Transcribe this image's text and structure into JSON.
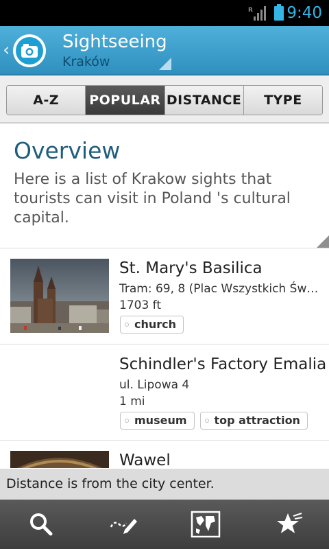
{
  "status_bar": {
    "time": "9:40",
    "roaming": "R",
    "accent_color": "#33b5e5"
  },
  "action_bar": {
    "title": "Sightseeing",
    "subtitle": "Kraków",
    "back_icon": "chevron-left-icon",
    "logo_icon": "camera-icon"
  },
  "tabs": [
    {
      "label": "A-Z",
      "active": false
    },
    {
      "label": "POPULAR",
      "active": true
    },
    {
      "label": "DISTANCE",
      "active": false
    },
    {
      "label": "TYPE",
      "active": false
    }
  ],
  "overview": {
    "title": "Overview",
    "text": "Here is a list of Krakow sights that tourists can visit in Poland 's cultural capital."
  },
  "items": [
    {
      "name": "St. Mary's Basilica",
      "address": "Tram: 69, 8 (Plac Wszystkich Świętych)",
      "distance": "1703 ft",
      "tags": [
        "church"
      ]
    },
    {
      "name": "Schindler's Factory Emalia",
      "address": "ul. Lipowa 4",
      "distance": "1 mi",
      "tags": [
        "museum",
        "top attraction"
      ]
    },
    {
      "name": "Wawel",
      "address": "",
      "distance": "",
      "tags": []
    }
  ],
  "toast": {
    "text": "Distance is from the city center."
  },
  "bottom_bar": {
    "icons": [
      "search-icon",
      "edit-icon",
      "map-icon",
      "favorites-icon"
    ]
  }
}
